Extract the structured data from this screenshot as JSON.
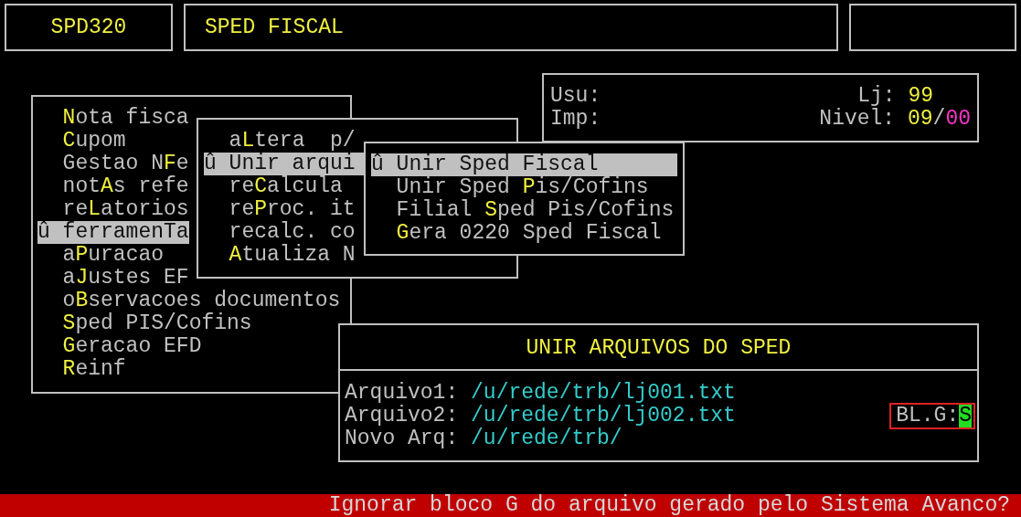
{
  "header": {
    "program_code": "SPD320",
    "title": "SPED FISCAL"
  },
  "info": {
    "user_label": "Usu:",
    "printer_label": "Imp:",
    "store_label": "Lj:",
    "store": "99",
    "level_label": "Nivel:",
    "level_major": "09",
    "level_separator": "/",
    "level_minor": "00"
  },
  "main_menu": {
    "items": [
      {
        "key": "N",
        "post": "ota fisca",
        "selected": false
      },
      {
        "key": "C",
        "post": "upom",
        "selected": false
      },
      {
        "pre": "Gestao N",
        "key": "F",
        "post": "e",
        "selected": false
      },
      {
        "pre": "not",
        "key": "A",
        "post": "s refe",
        "selected": false
      },
      {
        "pre": "re",
        "key": "L",
        "post": "atorios",
        "selected": false
      },
      {
        "marker": "û",
        "pre": "ferramenTa",
        "selected": true
      },
      {
        "pre": "a",
        "key": "P",
        "post": "uracao",
        "selected": false
      },
      {
        "pre": "a",
        "key": "J",
        "post": "ustes EF",
        "selected": false
      },
      {
        "pre": "o",
        "key": "B",
        "post": "servacoes documentos",
        "selected": false
      },
      {
        "key": "S",
        "post": "ped PIS/Cofins",
        "selected": false
      },
      {
        "key": "G",
        "post": "eracao EFD",
        "selected": false
      },
      {
        "key": "R",
        "post": "einf",
        "selected": false
      }
    ]
  },
  "submenu": {
    "items": [
      {
        "pre": "a",
        "key": "L",
        "post": "tera  p/",
        "selected": false
      },
      {
        "marker": "û",
        "pre": "Unir arqui",
        "selected": true
      },
      {
        "pre": "re",
        "key": "C",
        "post": "alcula",
        "selected": false
      },
      {
        "pre": "re",
        "key": "P",
        "post": "roc. it",
        "selected": false
      },
      {
        "pre": "recalc. co",
        "selected": false
      },
      {
        "key": "A",
        "post": "tualiza N",
        "selected": false
      }
    ]
  },
  "submenu_2": {
    "items": [
      {
        "marker": "û",
        "pre": "Unir Sped Fiscal",
        "selected": true
      },
      {
        "pre": "Unir Sped ",
        "key": "P",
        "post": "is/Cofins",
        "selected": false
      },
      {
        "pre": "Filial ",
        "key": "S",
        "post": "ped Pis/Cofins",
        "selected": false
      },
      {
        "key": "G",
        "post": "era 0220 Sped Fiscal",
        "selected": false
      }
    ]
  },
  "dialog": {
    "title": "UNIR ARQUIVOS DO SPED",
    "fields": [
      {
        "label": "Arquivo1:",
        "value": "/u/rede/trb/lj001.txt"
      },
      {
        "label": "Arquivo2:",
        "value": "/u/rede/trb/lj002.txt"
      },
      {
        "label": "Novo Arq:",
        "value": "/u/rede/trb/"
      }
    ],
    "option": {
      "label": "BL.G:",
      "value": "S"
    }
  },
  "status_bar": {
    "message": "Ignorar bloco G do arquivo gerado pelo Sistema Avanco?"
  }
}
